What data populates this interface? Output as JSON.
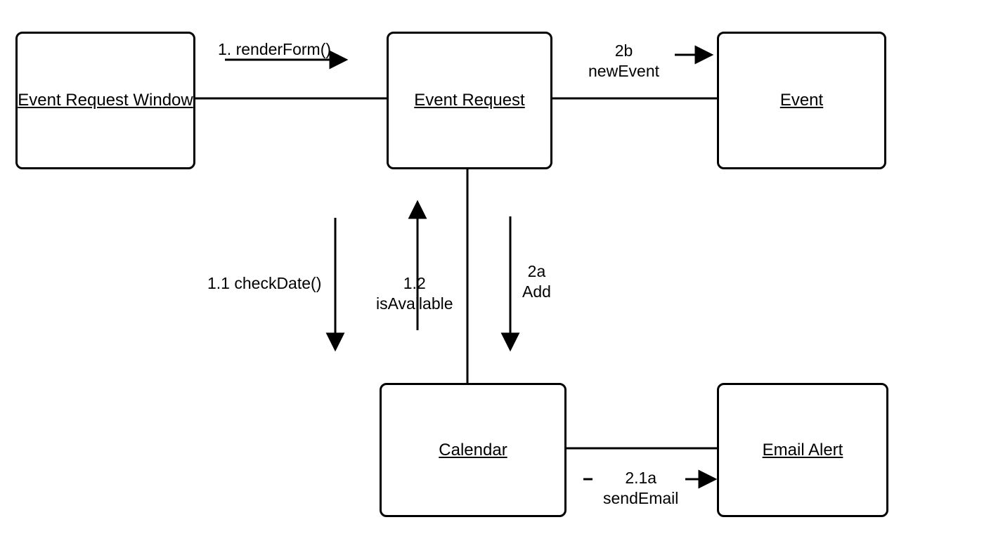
{
  "nodes": {
    "event_request_window": "Event Request\nWindow",
    "event_request": "Event Request",
    "event": "Event",
    "calendar": "Calendar",
    "email_alert": "Email Alert"
  },
  "messages": {
    "render_form": "1. renderForm()",
    "new_event": "2b\nnewEvent",
    "check_date": "1.1 checkDate()",
    "is_available": "1.2\nisAvailable",
    "add": "2a\nAdd",
    "send_email": "2.1a\nsendEmail"
  }
}
